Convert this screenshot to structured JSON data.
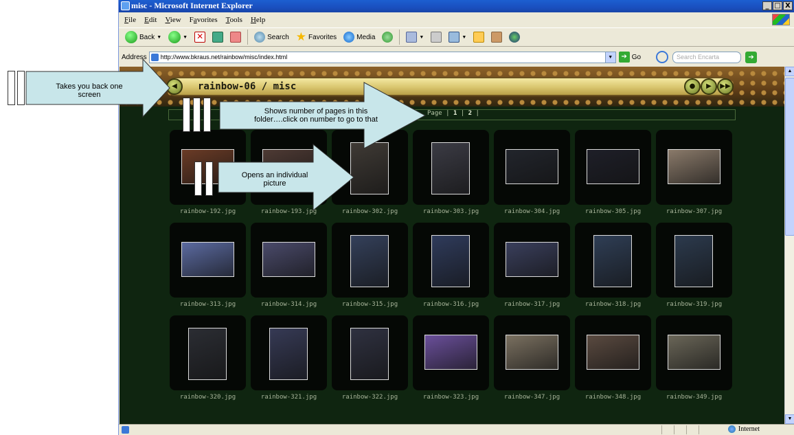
{
  "window": {
    "title": "misc - Microsoft Internet Explorer",
    "controls": [
      "_",
      "□",
      "X"
    ]
  },
  "menu": [
    {
      "label": "File",
      "key": "F",
      "rest": "ile"
    },
    {
      "label": "Edit",
      "key": "E",
      "rest": "dit"
    },
    {
      "label": "View",
      "key": "V",
      "rest": "iew"
    },
    {
      "label": "Favorites",
      "key": "a",
      "rest": ""
    },
    {
      "label": "Tools",
      "key": "T",
      "rest": "ools"
    },
    {
      "label": "Help",
      "key": "H",
      "rest": "elp"
    }
  ],
  "toolbar": {
    "back_label": "Back",
    "search_label": "Search",
    "favorites_label": "Favorites",
    "media_label": "Media"
  },
  "address": {
    "label": "Address",
    "url": "http://www.bkraus.net/rainbow/misc/index.html",
    "go_label": "Go",
    "encarta_placeholder": "Search Encarta"
  },
  "gallery": {
    "title": "rainbow-06 / misc",
    "pager_prefix": "Page |",
    "pages": [
      "1",
      "2"
    ],
    "pager_suffix": "|"
  },
  "thumbnails": [
    {
      "name": "rainbow-192.jpg",
      "orient": "land",
      "color": "#6a3b26"
    },
    {
      "name": "rainbow-193.jpg",
      "orient": "land",
      "color": "#4e3a34"
    },
    {
      "name": "rainbow-302.jpg",
      "orient": "port",
      "color": "#3f3a35"
    },
    {
      "name": "rainbow-303.jpg",
      "orient": "port",
      "color": "#3b3b44"
    },
    {
      "name": "rainbow-304.jpg",
      "orient": "land",
      "color": "#22252c"
    },
    {
      "name": "rainbow-305.jpg",
      "orient": "land",
      "color": "#1e1f28"
    },
    {
      "name": "rainbow-307.jpg",
      "orient": "land",
      "color": "#8a7a6a"
    },
    {
      "name": "rainbow-313.jpg",
      "orient": "land",
      "color": "#5b6aa0"
    },
    {
      "name": "rainbow-314.jpg",
      "orient": "land",
      "color": "#4a4a6a"
    },
    {
      "name": "rainbow-315.jpg",
      "orient": "port",
      "color": "#34405a"
    },
    {
      "name": "rainbow-316.jpg",
      "orient": "port",
      "color": "#2f3b5b"
    },
    {
      "name": "rainbow-317.jpg",
      "orient": "land",
      "color": "#3a3f5c"
    },
    {
      "name": "rainbow-318.jpg",
      "orient": "port",
      "color": "#2f3e55"
    },
    {
      "name": "rainbow-319.jpg",
      "orient": "port",
      "color": "#2c3a4d"
    },
    {
      "name": "rainbow-320.jpg",
      "orient": "port",
      "color": "#2b2d33"
    },
    {
      "name": "rainbow-321.jpg",
      "orient": "port",
      "color": "#363a55"
    },
    {
      "name": "rainbow-322.jpg",
      "orient": "port",
      "color": "#2f3140"
    },
    {
      "name": "rainbow-323.jpg",
      "orient": "land",
      "color": "#6a4f9a"
    },
    {
      "name": "rainbow-347.jpg",
      "orient": "land",
      "color": "#7a7060"
    },
    {
      "name": "rainbow-348.jpg",
      "orient": "land",
      "color": "#5a4a40"
    },
    {
      "name": "rainbow-349.jpg",
      "orient": "land",
      "color": "#6a6658"
    }
  ],
  "status": {
    "zone_label": "Internet"
  },
  "callouts": {
    "back": "Takes you back one screen",
    "pages": "Shows number of pages in this folder….click on number to go to that",
    "picture": "Opens an individual picture"
  },
  "colors": {
    "page_bg": "#0f2510",
    "title_bar": "#e3d27d",
    "arrow_fill": "#c8e6ea",
    "caption": "#a8b49a"
  }
}
